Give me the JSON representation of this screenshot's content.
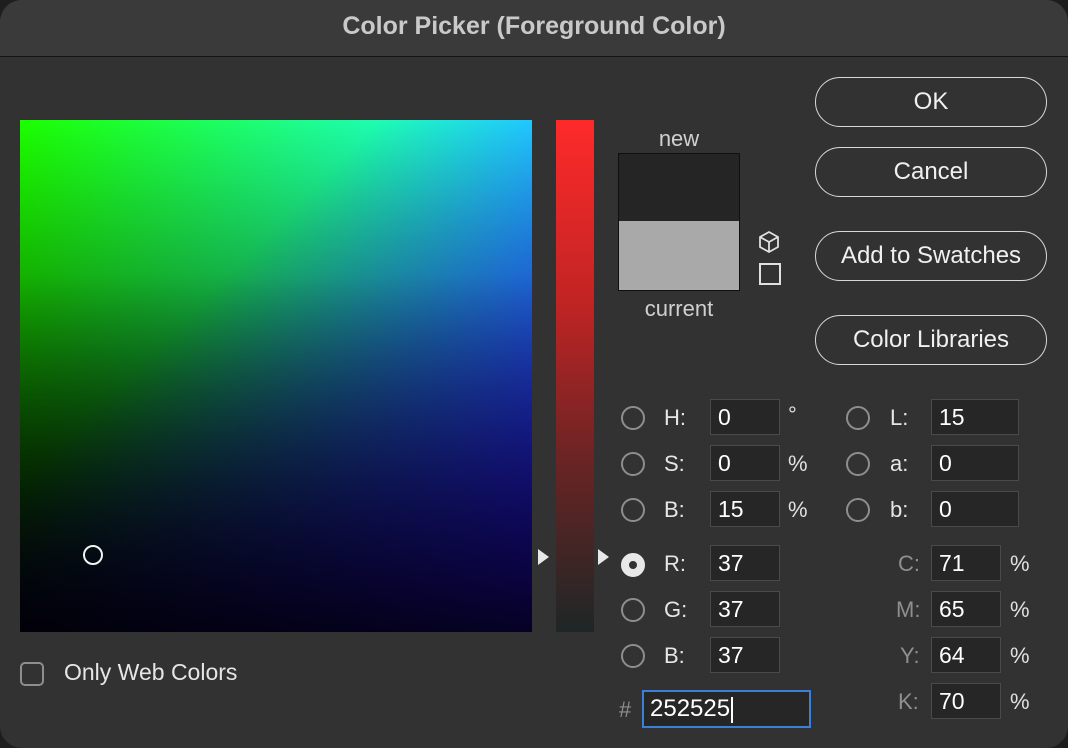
{
  "window": {
    "title": "Color Picker (Foreground Color)"
  },
  "buttons": {
    "ok": "OK",
    "cancel": "Cancel",
    "add_swatches": "Add to Swatches",
    "color_libraries": "Color Libraries"
  },
  "preview": {
    "new_label": "new",
    "current_label": "current",
    "new_color": "#252525",
    "current_color": "#a9a9a9"
  },
  "hsb": {
    "h_label": "H:",
    "h_value": "0",
    "h_unit": "°",
    "s_label": "S:",
    "s_value": "0",
    "s_unit": "%",
    "b_label": "B:",
    "b_value": "15",
    "b_unit": "%"
  },
  "lab": {
    "l_label": "L:",
    "l_value": "15",
    "a_label": "a:",
    "a_value": "0",
    "b_label": "b:",
    "b_value": "0"
  },
  "rgb": {
    "r_label": "R:",
    "r_value": "37",
    "g_label": "G:",
    "g_value": "37",
    "b_label": "B:",
    "b_value": "37"
  },
  "cmyk": {
    "c_label": "C:",
    "c_value": "71",
    "c_unit": "%",
    "m_label": "M:",
    "m_value": "65",
    "m_unit": "%",
    "y_label": "Y:",
    "y_value": "64",
    "y_unit": "%",
    "k_label": "K:",
    "k_value": "70",
    "k_unit": "%"
  },
  "hex": {
    "prefix": "#",
    "value": "252525"
  },
  "web_colors": {
    "label": "Only Web Colors",
    "checked": false
  },
  "selected_mode": "R",
  "icons": {
    "gamut": "cube-icon",
    "web_safe": "square-icon"
  }
}
